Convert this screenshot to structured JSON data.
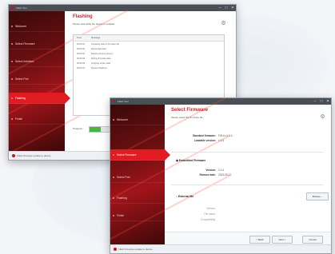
{
  "back_window": {
    "title": "Flash Tool",
    "controls": [
      "–",
      "□",
      "✕"
    ],
    "nav": [
      {
        "label": "Welcome"
      },
      {
        "label": "Select Firmware"
      },
      {
        "label": "Select Interface"
      },
      {
        "label": "Select Port"
      },
      {
        "label": "Flashing"
      },
      {
        "label": "Finish"
      }
    ],
    "page_title": "Flashing",
    "page_subtitle": "Please wait while the device is updated.",
    "log": {
      "headers": [
        "Time",
        "Message"
      ],
      "rows": [
        {
          "time": "00:00:01",
          "message": "Preparing flash of firmware file"
        },
        {
          "time": "00:00:02",
          "message": "Device detected"
        },
        {
          "time": "00:00:04",
          "message": "Erasing device memory"
        },
        {
          "time": "00:00:06",
          "message": "Writing firmware data"
        },
        {
          "time": "00:00:09",
          "message": "Verifying written data"
        },
        {
          "time": "00:00:12",
          "message": "Device initialized"
        }
      ]
    },
    "progress_label": "Progress",
    "progress_value": 0.35,
    "status": "Flash firmware update to device"
  },
  "front_window": {
    "title": "Flash Tool",
    "controls": [
      "–",
      "□",
      "✕"
    ],
    "nav": [
      {
        "label": "Welcome"
      },
      {
        "label": "Select Firmware"
      },
      {
        "label": "Select Port"
      },
      {
        "label": "Flashing"
      },
      {
        "label": "Finish"
      }
    ],
    "page_title": "Select Firmware",
    "page_subtitle": "Please select the firmware file.",
    "standard": {
      "fields": [
        {
          "label": "Standard firmware:",
          "value": "FW-A v1.0.4"
        },
        {
          "label": "Loadable version:",
          "value": "1.0.4"
        }
      ]
    },
    "embedded": {
      "heading": "Embedded Firmware",
      "fields": [
        {
          "label": "Version:",
          "value": "1.0.4"
        },
        {
          "label": "Release date:",
          "value": "2023-05-12"
        }
      ]
    },
    "external": {
      "heading": "External file",
      "browse_label": "Browse...",
      "fields": [
        {
          "label": "Version:"
        },
        {
          "label": "File name:"
        },
        {
          "label": "Compatibility:"
        }
      ]
    },
    "buttons": {
      "back": "< Back",
      "next": "Next >",
      "cancel": "Cancel"
    },
    "status": "Flash firmware update to device"
  }
}
